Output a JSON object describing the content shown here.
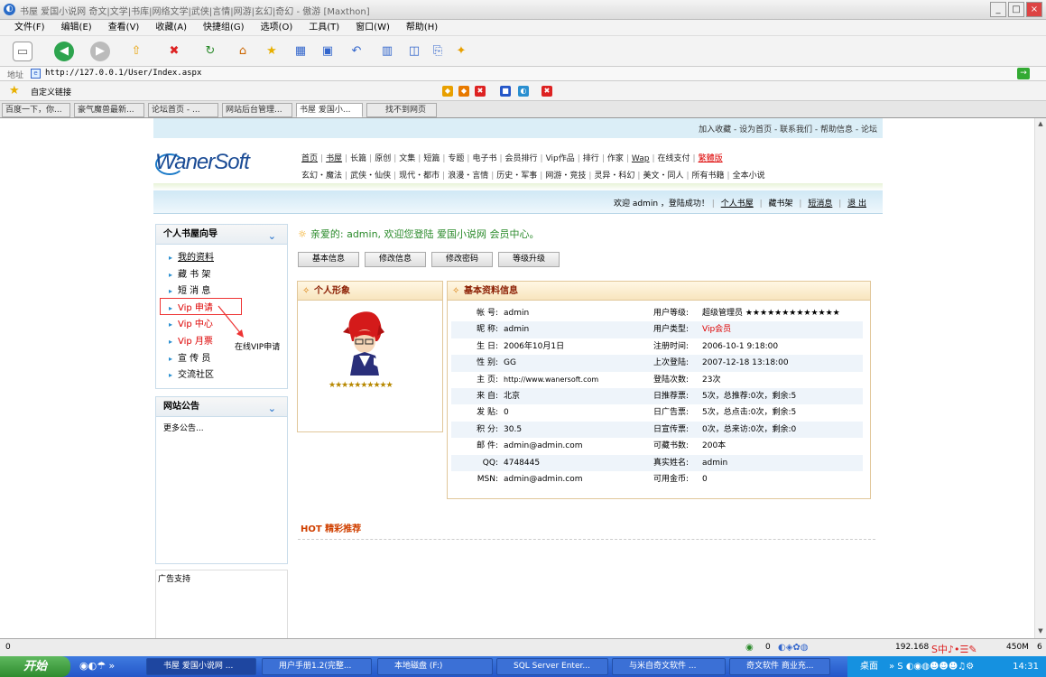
{
  "window": {
    "title": "书屋  爱国小说网 奇文|文学|书库|网络文学|武侠|言情|网游|玄幻|奇幻 - 傲游 [Maxthon]"
  },
  "menu": [
    "文件(F)",
    "编辑(E)",
    "查看(V)",
    "收藏(A)",
    "快捷组(G)",
    "选项(O)",
    "工具(T)",
    "窗口(W)",
    "帮助(H)"
  ],
  "address": {
    "label": "地址",
    "url": "http://127.0.0.1/User/Index.aspx"
  },
  "favorites": {
    "label": "自定义链接"
  },
  "tabs": [
    "百度一下，你...",
    "豪气魔兽最新...",
    "论坛首页 - ...",
    "网站后台管理...",
    "书屋 爱国小...",
    "找不到网页"
  ],
  "site": {
    "toplinks": "加入收藏 - 设为首页 - 联系我们 - 帮助信息 - 论坛",
    "logo": "WanerSoft",
    "nav1": [
      "首页",
      "书屋",
      "长篇",
      "原创",
      "文集",
      "短篇",
      "专题",
      "电子书",
      "会员排行",
      "Vip作品",
      "排行",
      "作家",
      "Wap",
      "在线支付",
      "繁體版"
    ],
    "nav2": [
      "玄幻・魔法",
      "武侠・仙侠",
      "现代・都市",
      "浪漫・言情",
      "历史・军事",
      "网游・竞技",
      "灵异・科幻",
      "美文・同人",
      "所有书籍",
      "全本小说"
    ],
    "welcome": {
      "text": "欢迎 admin ，登陆成功！",
      "links": [
        "个人书屋",
        "藏书架",
        "短消息",
        "退 出"
      ]
    },
    "sidebar": {
      "title": "个人书屋向导",
      "items": [
        "我的资料",
        "藏 书 架",
        "短 消 息",
        "Vip 申请",
        "Vip 中心",
        "Vip 月票",
        "宣 传 员",
        "交流社区"
      ],
      "vip_note": "在线VIP申请"
    },
    "notice": {
      "title": "网站公告",
      "more": "更多公告..."
    },
    "ads": {
      "title": "广告支持"
    },
    "greeting": "亲爱的: admin, 欢迎您登陆 爱国小说网 会员中心。",
    "buttons": [
      "基本信息",
      "修改信息",
      "修改密码",
      "等级升级"
    ],
    "profile_title": "个人形象",
    "profile_stars": "★★★★★★★★★★",
    "info_title": "基本资料信息",
    "info_rows": [
      {
        "k1": "帐 号:",
        "v1": "admin",
        "k2": "用户等级:",
        "v2": "超级管理员 ★★★★★★★★★★★★★"
      },
      {
        "k1": "昵 称:",
        "v1": "admin",
        "k2": "用户类型:",
        "v2": "Vip会员"
      },
      {
        "k1": "生 日:",
        "v1": "2006年10月1日",
        "k2": "注册时间:",
        "v2": "2006-10-1 9:18:00"
      },
      {
        "k1": "性 别:",
        "v1": "GG",
        "k2": "上次登陆:",
        "v2": "2007-12-18 13:18:00"
      },
      {
        "k1": "主 页:",
        "v1": "http://www.wanersoft.com",
        "k2": "登陆次数:",
        "v2": "23次"
      },
      {
        "k1": "来 自:",
        "v1": "北京",
        "k2": "日推荐票:",
        "v2": "5次，总推荐:0次，剩余:5"
      },
      {
        "k1": "发 贴:",
        "v1": "0",
        "k2": "日广告票:",
        "v2": "5次，总点击:0次，剩余:5"
      },
      {
        "k1": "积 分:",
        "v1": "30.5",
        "k2": "日宣传票:",
        "v2": "0次，总来访:0次，剩余:0"
      },
      {
        "k1": "邮 件:",
        "v1": "admin@admin.com",
        "k2": "可藏书数:",
        "v2": "200本"
      },
      {
        "k1": "QQ:",
        "v1": "4748445",
        "k2": "真实姓名:",
        "v2": "admin"
      },
      {
        "k1": "MSN:",
        "v1": "admin@admin.com",
        "k2": "可用金币:",
        "v2": "0"
      }
    ],
    "hot": "HOT 精彩推荐"
  },
  "statusbar": {
    "left": "0",
    "ip": "192.168",
    "mem": "450M",
    "num": "6",
    "zero": "0"
  },
  "taskbar": {
    "start": "开始",
    "tasks": [
      "书屋 爱国小说网 ...",
      "用户手册1.2(完整...",
      "本地磁盘 (F:)",
      "SQL Server Enter...",
      "与米自奇文软件 ...",
      "奇文软件 商业充..."
    ],
    "desktop": "桌面",
    "time": "14:31"
  }
}
